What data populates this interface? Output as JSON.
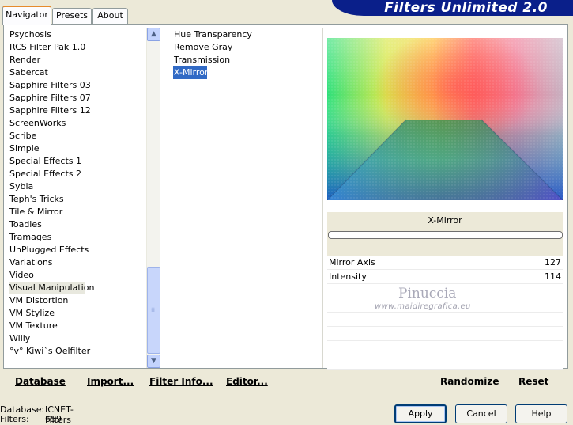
{
  "tabs": [
    {
      "label": "Navigator",
      "active": true
    },
    {
      "label": "Presets",
      "active": false
    },
    {
      "label": "About",
      "active": false
    }
  ],
  "title": "Filters Unlimited 2.0",
  "categories": [
    "Psychosis",
    "RCS Filter Pak 1.0",
    "Render",
    "Sabercat",
    "Sapphire Filters 03",
    "Sapphire Filters 07",
    "Sapphire Filters 12",
    "ScreenWorks",
    "Scribe",
    "Simple",
    "Special Effects 1",
    "Special Effects 2",
    "Sybia",
    "Teph's Tricks",
    "Tile & Mirror",
    "Toadies",
    "Tramages",
    "UnPlugged Effects",
    "Variations",
    "Video",
    "Visual Manipulation",
    "VM Distortion",
    "VM Stylize",
    "VM Texture",
    "Willy",
    "°v° Kiwi`s Oelfilter"
  ],
  "selected_category": "Visual Manipulation",
  "filters": [
    "Hue Transparency",
    "Remove Gray",
    "Transmission",
    "X-Mirror"
  ],
  "selected_filter": "X-Mirror",
  "preview_filter_name": "X-Mirror",
  "params": [
    {
      "label": "Mirror Axis",
      "value": "127"
    },
    {
      "label": "Intensity",
      "value": "114"
    }
  ],
  "watermark": {
    "line1": "Pinuccia",
    "line2": "www.maidiregrafica.eu"
  },
  "bottom_buttons": {
    "database": "Database",
    "import": "Import...",
    "filter_info": "Filter Info...",
    "editor": "Editor...",
    "randomize": "Randomize",
    "reset": "Reset"
  },
  "footer": {
    "database_label": "Database:",
    "database_value": "ICNET-Filters",
    "filters_label": "Filters:",
    "filters_value": "659"
  },
  "dialog_buttons": {
    "apply": "Apply",
    "cancel": "Cancel",
    "help": "Help"
  },
  "colors": {
    "banner": "#0a1f8a",
    "selection": "#316ac5",
    "window": "#ece9d8"
  }
}
